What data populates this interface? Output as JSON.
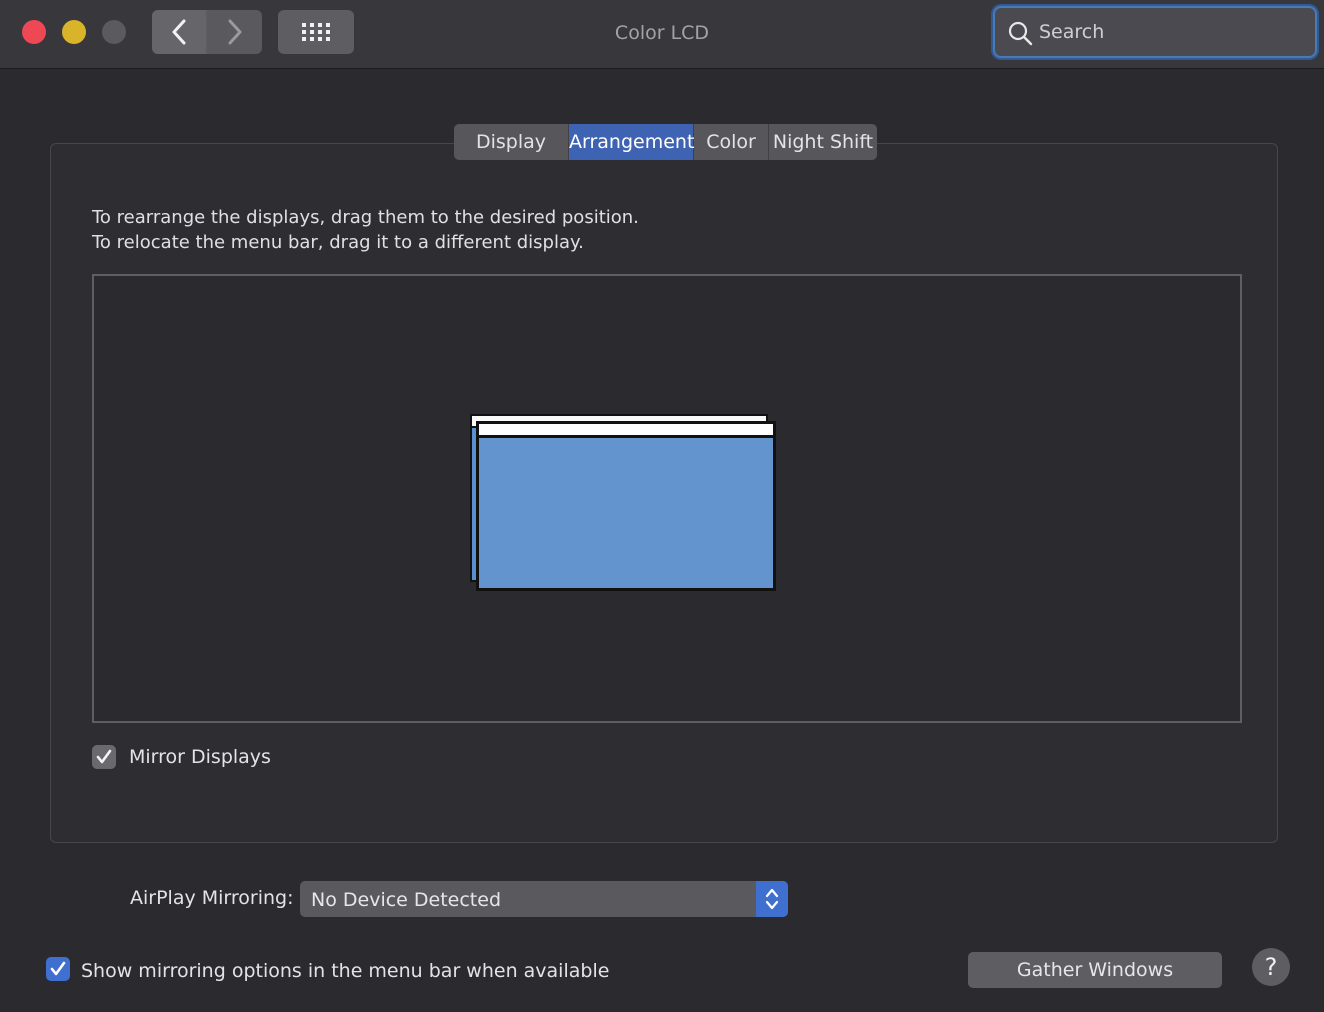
{
  "window": {
    "title": "Color LCD"
  },
  "toolbar": {
    "back_icon": "chevron-left-icon",
    "forward_icon": "chevron-right-icon",
    "grid_icon": "show-all-grid-icon"
  },
  "search": {
    "placeholder": "Search",
    "icon": "search-icon"
  },
  "tabs": [
    {
      "label": "Display",
      "selected": false
    },
    {
      "label": "Arrangement",
      "selected": true
    },
    {
      "label": "Color",
      "selected": false
    },
    {
      "label": "Night Shift",
      "selected": false
    }
  ],
  "arrangement": {
    "instruction_1": "To rearrange the displays, drag them to the desired position.",
    "instruction_2": "To relocate the menu bar, drag it to a different display.",
    "display_color": "#6394cd"
  },
  "mirror": {
    "label": "Mirror Displays",
    "checked": true
  },
  "airplay": {
    "label": "AirPlay Mirroring:",
    "value": "No Device Detected"
  },
  "show_mirroring": {
    "label": "Show mirroring options in the menu bar when available",
    "checked": true
  },
  "gather": {
    "label": "Gather Windows"
  },
  "help": {
    "label": "?"
  },
  "colors": {
    "accent": "#3f63b3",
    "checkbox_accent": "#3f6fcf",
    "close": "#ef4855",
    "minimize": "#d9b42b"
  }
}
